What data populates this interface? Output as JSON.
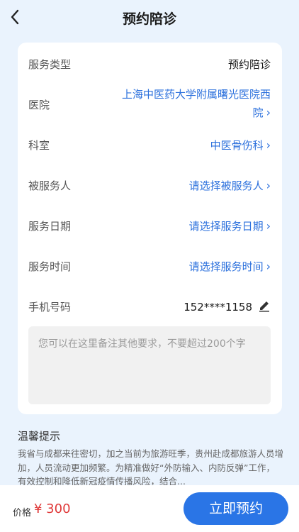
{
  "header": {
    "title": "预约陪诊"
  },
  "form": {
    "service_type": {
      "label": "服务类型",
      "value": "预约陪诊"
    },
    "hospital": {
      "label": "医院",
      "value": "上海中医药大学附属曙光医院西院"
    },
    "department": {
      "label": "科室",
      "value": "中医骨伤科"
    },
    "patient": {
      "label": "被服务人",
      "value": "请选择被服务人"
    },
    "date": {
      "label": "服务日期",
      "value": "请选择服务日期"
    },
    "time": {
      "label": "服务时间",
      "value": "请选择服务时间"
    },
    "phone": {
      "label": "手机号码",
      "value": "152****1158"
    },
    "note_placeholder": "您可以在这里备注其他要求，不要超过200个字"
  },
  "tips": {
    "title": "温馨提示",
    "body": "我省与成都来往密切，加之当前为旅游旺季，贵州赴成都旅游人员增加，人员流动更加频繁。为精准做好“外防输入、内防反弹”工作，有效控制和降低新冠疫情传播风险，结合..."
  },
  "footer": {
    "price_label": "价格",
    "price_value": "¥ 300",
    "submit_label": "立即预约"
  },
  "icons": {
    "back": "chevron-left-icon",
    "chevron": "chevron-right-icon",
    "edit": "pencil-icon"
  },
  "colors": {
    "accent": "#2a75e6",
    "link": "#2a6fdc",
    "price": "#e03a3a",
    "background": "#eaf3fd"
  }
}
